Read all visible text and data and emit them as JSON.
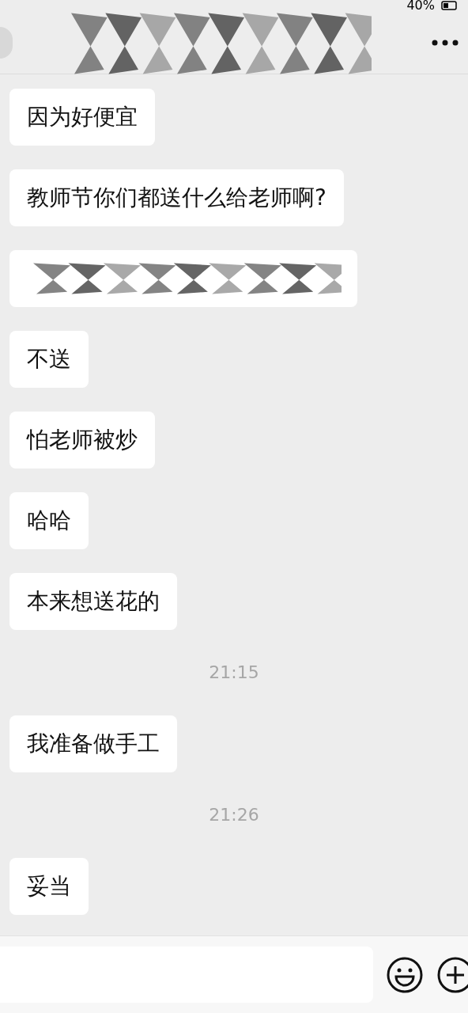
{
  "status_bar": {
    "battery": "40%"
  },
  "messages": [
    {
      "kind": "text",
      "text": "因为好便宜"
    },
    {
      "kind": "text",
      "text": "教师节你们都送什么给老师啊?"
    },
    {
      "kind": "redacted"
    },
    {
      "kind": "text",
      "text": "不送"
    },
    {
      "kind": "text",
      "text": "怕老师被炒"
    },
    {
      "kind": "text",
      "text": "哈哈"
    },
    {
      "kind": "text",
      "text": "本来想送花的"
    },
    {
      "kind": "time",
      "text": "21:15"
    },
    {
      "kind": "text",
      "text": "我准备做手工"
    },
    {
      "kind": "time",
      "text": "21:26"
    },
    {
      "kind": "text",
      "text": "妥当"
    }
  ]
}
